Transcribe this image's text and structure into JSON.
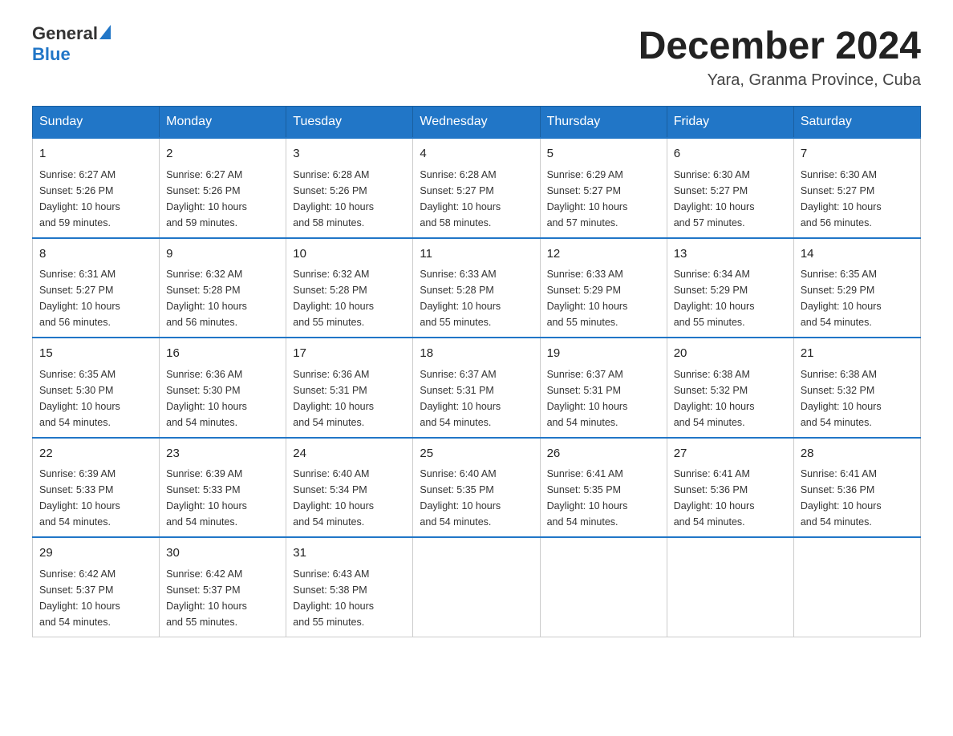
{
  "logo": {
    "line1": "General",
    "line2": "Blue"
  },
  "title": "December 2024",
  "location": "Yara, Granma Province, Cuba",
  "days_header": [
    "Sunday",
    "Monday",
    "Tuesday",
    "Wednesday",
    "Thursday",
    "Friday",
    "Saturday"
  ],
  "weeks": [
    [
      {
        "day": "1",
        "sunrise": "6:27 AM",
        "sunset": "5:26 PM",
        "daylight": "10 hours and 59 minutes."
      },
      {
        "day": "2",
        "sunrise": "6:27 AM",
        "sunset": "5:26 PM",
        "daylight": "10 hours and 59 minutes."
      },
      {
        "day": "3",
        "sunrise": "6:28 AM",
        "sunset": "5:26 PM",
        "daylight": "10 hours and 58 minutes."
      },
      {
        "day": "4",
        "sunrise": "6:28 AM",
        "sunset": "5:27 PM",
        "daylight": "10 hours and 58 minutes."
      },
      {
        "day": "5",
        "sunrise": "6:29 AM",
        "sunset": "5:27 PM",
        "daylight": "10 hours and 57 minutes."
      },
      {
        "day": "6",
        "sunrise": "6:30 AM",
        "sunset": "5:27 PM",
        "daylight": "10 hours and 57 minutes."
      },
      {
        "day": "7",
        "sunrise": "6:30 AM",
        "sunset": "5:27 PM",
        "daylight": "10 hours and 56 minutes."
      }
    ],
    [
      {
        "day": "8",
        "sunrise": "6:31 AM",
        "sunset": "5:27 PM",
        "daylight": "10 hours and 56 minutes."
      },
      {
        "day": "9",
        "sunrise": "6:32 AM",
        "sunset": "5:28 PM",
        "daylight": "10 hours and 56 minutes."
      },
      {
        "day": "10",
        "sunrise": "6:32 AM",
        "sunset": "5:28 PM",
        "daylight": "10 hours and 55 minutes."
      },
      {
        "day": "11",
        "sunrise": "6:33 AM",
        "sunset": "5:28 PM",
        "daylight": "10 hours and 55 minutes."
      },
      {
        "day": "12",
        "sunrise": "6:33 AM",
        "sunset": "5:29 PM",
        "daylight": "10 hours and 55 minutes."
      },
      {
        "day": "13",
        "sunrise": "6:34 AM",
        "sunset": "5:29 PM",
        "daylight": "10 hours and 55 minutes."
      },
      {
        "day": "14",
        "sunrise": "6:35 AM",
        "sunset": "5:29 PM",
        "daylight": "10 hours and 54 minutes."
      }
    ],
    [
      {
        "day": "15",
        "sunrise": "6:35 AM",
        "sunset": "5:30 PM",
        "daylight": "10 hours and 54 minutes."
      },
      {
        "day": "16",
        "sunrise": "6:36 AM",
        "sunset": "5:30 PM",
        "daylight": "10 hours and 54 minutes."
      },
      {
        "day": "17",
        "sunrise": "6:36 AM",
        "sunset": "5:31 PM",
        "daylight": "10 hours and 54 minutes."
      },
      {
        "day": "18",
        "sunrise": "6:37 AM",
        "sunset": "5:31 PM",
        "daylight": "10 hours and 54 minutes."
      },
      {
        "day": "19",
        "sunrise": "6:37 AM",
        "sunset": "5:31 PM",
        "daylight": "10 hours and 54 minutes."
      },
      {
        "day": "20",
        "sunrise": "6:38 AM",
        "sunset": "5:32 PM",
        "daylight": "10 hours and 54 minutes."
      },
      {
        "day": "21",
        "sunrise": "6:38 AM",
        "sunset": "5:32 PM",
        "daylight": "10 hours and 54 minutes."
      }
    ],
    [
      {
        "day": "22",
        "sunrise": "6:39 AM",
        "sunset": "5:33 PM",
        "daylight": "10 hours and 54 minutes."
      },
      {
        "day": "23",
        "sunrise": "6:39 AM",
        "sunset": "5:33 PM",
        "daylight": "10 hours and 54 minutes."
      },
      {
        "day": "24",
        "sunrise": "6:40 AM",
        "sunset": "5:34 PM",
        "daylight": "10 hours and 54 minutes."
      },
      {
        "day": "25",
        "sunrise": "6:40 AM",
        "sunset": "5:35 PM",
        "daylight": "10 hours and 54 minutes."
      },
      {
        "day": "26",
        "sunrise": "6:41 AM",
        "sunset": "5:35 PM",
        "daylight": "10 hours and 54 minutes."
      },
      {
        "day": "27",
        "sunrise": "6:41 AM",
        "sunset": "5:36 PM",
        "daylight": "10 hours and 54 minutes."
      },
      {
        "day": "28",
        "sunrise": "6:41 AM",
        "sunset": "5:36 PM",
        "daylight": "10 hours and 54 minutes."
      }
    ],
    [
      {
        "day": "29",
        "sunrise": "6:42 AM",
        "sunset": "5:37 PM",
        "daylight": "10 hours and 54 minutes."
      },
      {
        "day": "30",
        "sunrise": "6:42 AM",
        "sunset": "5:37 PM",
        "daylight": "10 hours and 55 minutes."
      },
      {
        "day": "31",
        "sunrise": "6:43 AM",
        "sunset": "5:38 PM",
        "daylight": "10 hours and 55 minutes."
      },
      null,
      null,
      null,
      null
    ]
  ],
  "labels": {
    "sunrise": "Sunrise:",
    "sunset": "Sunset:",
    "daylight": "Daylight:"
  }
}
